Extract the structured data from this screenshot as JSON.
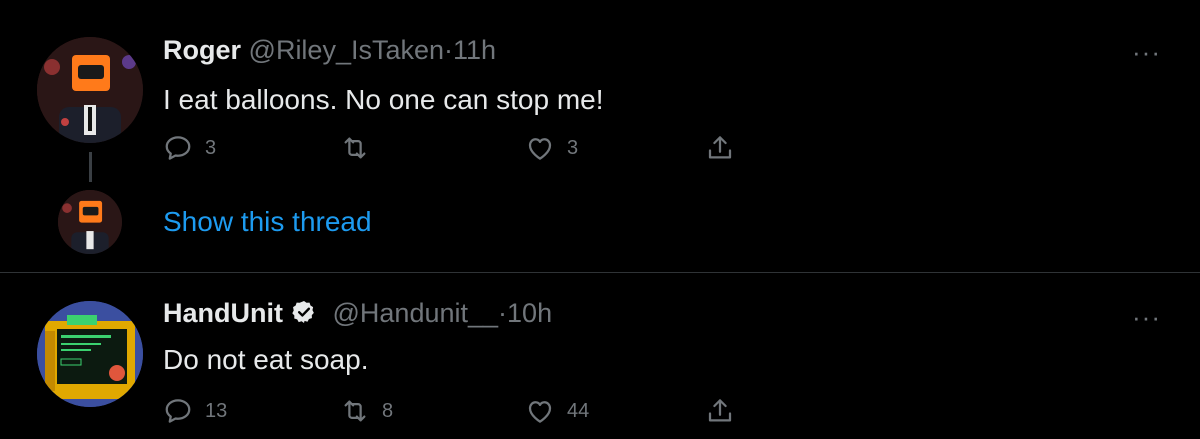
{
  "tweets": [
    {
      "name": "Roger",
      "handle": "@Riley_IsTaken",
      "separator": "·",
      "time": "11h",
      "text": "I eat balloons. No one can stop me!",
      "replies": "3",
      "retweets": "",
      "likes": "3",
      "more": "···",
      "avatar": "orange-box-head-suit-avatar"
    },
    {
      "name": "HandUnit",
      "verified": true,
      "handle": "@Handunit__",
      "separator": "·",
      "time": "10h",
      "text": "Do not eat soap.",
      "replies": "13",
      "retweets": "8",
      "likes": "44",
      "more": "···",
      "avatar": "yellow-monitor-robot-avatar"
    }
  ],
  "thread": {
    "show_label": "Show this thread"
  },
  "colors": {
    "background": "#000000",
    "accent": "#1d9bf0",
    "muted": "#71767b",
    "text": "#e7e9ea"
  },
  "icons": [
    "reply-icon",
    "retweet-icon",
    "like-icon",
    "share-icon",
    "verified-icon",
    "more-icon"
  ]
}
